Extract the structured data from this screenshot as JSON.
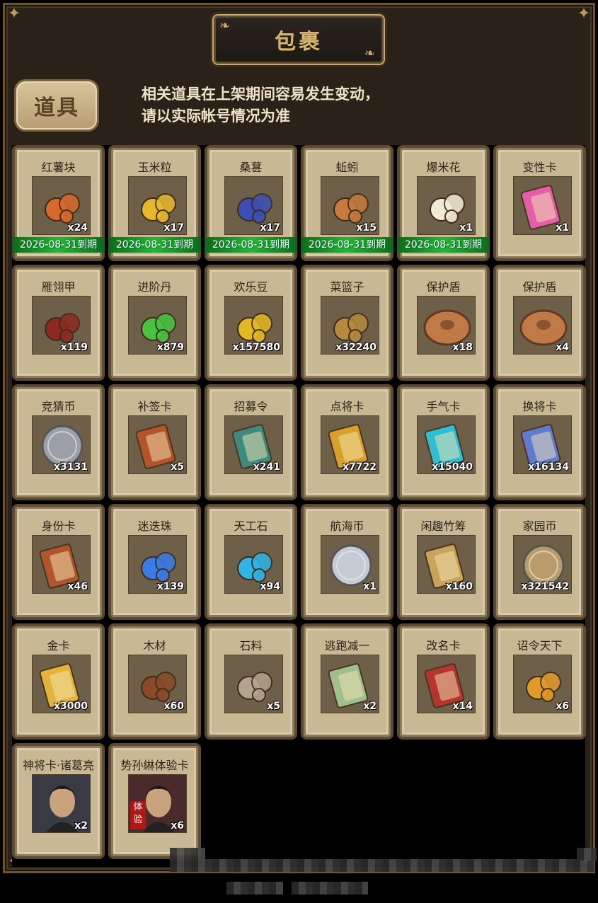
{
  "header": {
    "title": "包裹",
    "tab_label": "道具",
    "notice_lines": [
      "相关道具在上架期间容易发生变动，",
      "请以实际帐号情况为准"
    ]
  },
  "items": [
    {
      "name": "红薯块",
      "qty": "x24",
      "expire": "2026-08-31到期",
      "icon": "sweet-potato-icon",
      "color": "#d9692a"
    },
    {
      "name": "玉米粒",
      "qty": "x17",
      "expire": "2026-08-31到期",
      "icon": "corn-icon",
      "color": "#e8b82c"
    },
    {
      "name": "桑葚",
      "qty": "x17",
      "expire": "2026-08-31到期",
      "icon": "mulberry-icon",
      "color": "#3c4fb8"
    },
    {
      "name": "蚯蚓",
      "qty": "x15",
      "expire": "2026-08-31到期",
      "icon": "earthworm-icon",
      "color": "#c77a3e"
    },
    {
      "name": "爆米花",
      "qty": "x1",
      "expire": "2026-08-31到期",
      "icon": "popcorn-icon",
      "color": "#f2ead6"
    },
    {
      "name": "变性卡",
      "qty": "x1",
      "icon": "gender-card-icon",
      "color": "#e35fa8"
    },
    {
      "name": "雁翎甲",
      "qty": "x119",
      "icon": "armor-icon",
      "color": "#8c2a22"
    },
    {
      "name": "进阶丹",
      "qty": "x879",
      "icon": "advance-pill-icon",
      "color": "#49c23f"
    },
    {
      "name": "欢乐豆",
      "qty": "x157580",
      "icon": "happy-bean-icon",
      "color": "#e3b825"
    },
    {
      "name": "菜篮子",
      "qty": "x32240",
      "icon": "basket-icon",
      "color": "#b58a3e"
    },
    {
      "name": "保护盾",
      "qty": "x18",
      "icon": "shield-icon",
      "color": "#c07a46"
    },
    {
      "name": "保护盾",
      "qty": "x4",
      "icon": "shield-icon",
      "color": "#c07a46"
    },
    {
      "name": "竞猜币",
      "qty": "x3131",
      "icon": "guess-coin-icon",
      "color": "#9aa0a6"
    },
    {
      "name": "补签卡",
      "qty": "x5",
      "icon": "resign-card-icon",
      "color": "#b3542b"
    },
    {
      "name": "招募令",
      "qty": "x241",
      "icon": "recruit-token-icon",
      "color": "#3e8a7c"
    },
    {
      "name": "点将卡",
      "qty": "x7722",
      "icon": "general-card-icon",
      "color": "#d6a22a"
    },
    {
      "name": "手气卡",
      "qty": "x15040",
      "icon": "luck-card-icon",
      "color": "#2fbfd0"
    },
    {
      "name": "换将卡",
      "qty": "x16134",
      "icon": "swap-card-icon",
      "color": "#5e7bd0"
    },
    {
      "name": "身份卡",
      "qty": "x46",
      "icon": "identity-card-icon",
      "color": "#b0562a"
    },
    {
      "name": "迷迭珠",
      "qty": "x139",
      "icon": "rosemary-orb-icon",
      "color": "#3a7be8"
    },
    {
      "name": "天工石",
      "qty": "x94",
      "icon": "crystal-stone-icon",
      "color": "#2fb4e6"
    },
    {
      "name": "航海币",
      "qty": "x1",
      "icon": "voyage-coin-icon",
      "color": "#c5cbd4"
    },
    {
      "name": "闲趣竹筹",
      "qty": "x160",
      "icon": "bamboo-token-icon",
      "color": "#c9a35a"
    },
    {
      "name": "家园币",
      "qty": "x321542",
      "icon": "home-coin-icon",
      "color": "#b89c6a"
    },
    {
      "name": "金卡",
      "qty": "x3000",
      "icon": "gold-card-icon",
      "color": "#e2b43a"
    },
    {
      "name": "木材",
      "qty": "x60",
      "icon": "wood-icon",
      "color": "#8a4a2a"
    },
    {
      "name": "石料",
      "qty": "x5",
      "icon": "stone-icon",
      "color": "#b3a38c"
    },
    {
      "name": "逃跑减一",
      "qty": "x2",
      "icon": "escape-tag-icon",
      "color": "#9fbf8e"
    },
    {
      "name": "改名卡",
      "qty": "x14",
      "icon": "rename-card-icon",
      "color": "#b5342e"
    },
    {
      "name": "诏令天下",
      "qty": "x6",
      "icon": "edict-scroll-icon",
      "color": "#e39a2a"
    },
    {
      "name": "神将卡·诸葛亮",
      "qty": "x2",
      "icon": "zhuge-liang-portrait",
      "color": "#3a3a44"
    },
    {
      "name": "势孙綝体验卡",
      "qty": "x6",
      "badge": "体验",
      "icon": "sun-chen-portrait",
      "color": "#4a2a2a"
    }
  ]
}
